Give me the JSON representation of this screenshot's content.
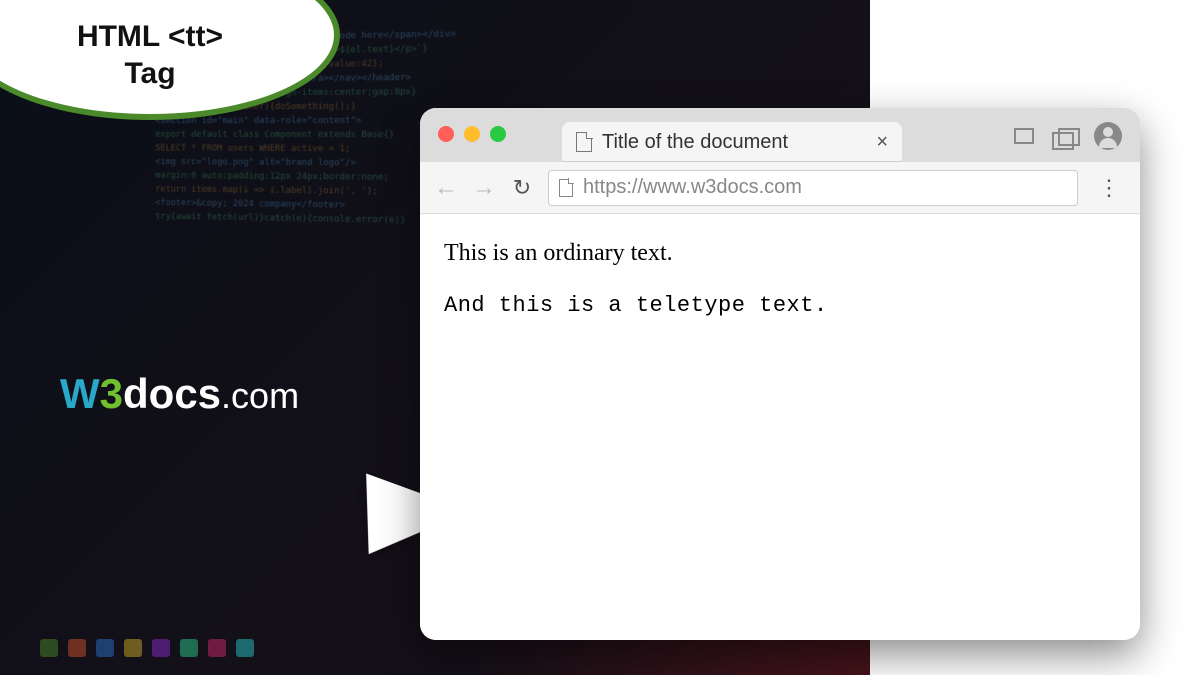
{
  "topic": {
    "line1": "HTML <tt>",
    "line2": "Tag"
  },
  "brand": {
    "w": "W",
    "three": "3",
    "docs": "docs",
    "suffix": ".com"
  },
  "browser": {
    "tab_title": "Title of the document",
    "url": "https://www.w3docs.com"
  },
  "page": {
    "ordinary_text": "This is an ordinary text.",
    "teletype_text": "And this is a teletype text."
  },
  "taskbar_colors": [
    "#4a8a2a",
    "#c94f2a",
    "#2a6fc9",
    "#c9a82a",
    "#8a2ac9",
    "#2ac98a",
    "#c92a6f",
    "#2ac4c9"
  ]
}
